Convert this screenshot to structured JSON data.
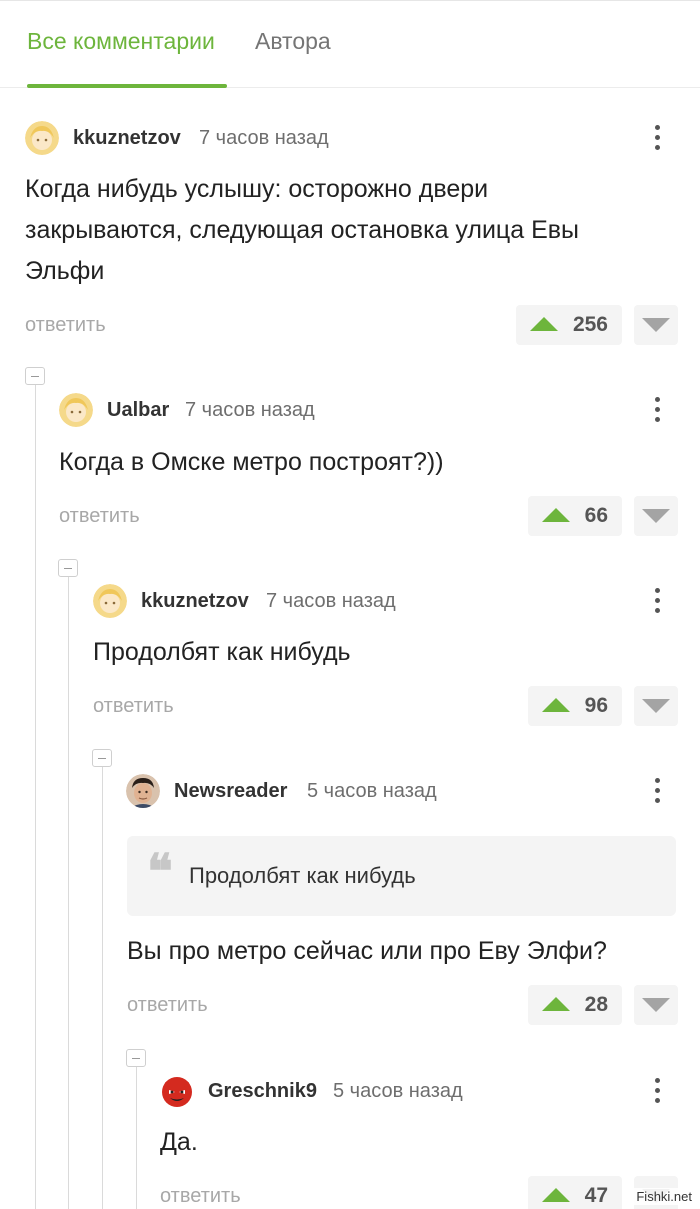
{
  "tabs": {
    "all_comments": "Все комментарии",
    "authors": "Автора"
  },
  "reply_label": "ответить",
  "colors": {
    "accent": "#6db53c",
    "vote_down": "#a4a4a4"
  },
  "comments": [
    {
      "author": "kkuznetzov",
      "time": "7 часов назад",
      "avatar_icon": "blonde-avatar-icon",
      "text": "Когда нибудь услышу: осторожно двери закрываются, следующая остановка улица Евы Эльфи",
      "votes": "256"
    },
    {
      "author": "Ualbar",
      "time": "7 часов назад",
      "avatar_icon": "blonde-avatar-icon",
      "text": "Когда в Омске метро построят?))",
      "votes": "66"
    },
    {
      "author": "kkuznetzov",
      "time": "7 часов назад",
      "avatar_icon": "blonde-avatar-icon",
      "text": "Продолбят как нибудь",
      "votes": "96"
    },
    {
      "author": "Newsreader",
      "time": "5 часов назад",
      "avatar_icon": "man-photo-avatar-icon",
      "quote": "Продолбят как нибудь",
      "text": "Вы про метро сейчас или про Еву Элфи?",
      "votes": "28"
    },
    {
      "author": "Greschnik9",
      "time": "5 часов назад",
      "avatar_icon": "devil-avatar-icon",
      "text": "Да.",
      "votes": "47"
    }
  ],
  "watermark": "Fishki.net"
}
